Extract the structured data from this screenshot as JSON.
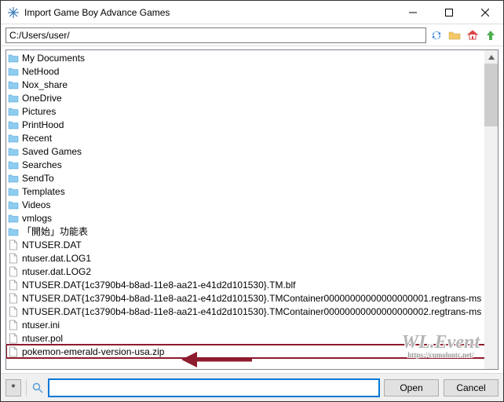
{
  "window": {
    "title": "Import Game Boy Advance Games"
  },
  "toolbar": {
    "path": "C:/Users/user/"
  },
  "files": [
    {
      "type": "folder",
      "name": "My Documents"
    },
    {
      "type": "folder",
      "name": "NetHood"
    },
    {
      "type": "folder",
      "name": "Nox_share"
    },
    {
      "type": "folder",
      "name": "OneDrive"
    },
    {
      "type": "folder",
      "name": "Pictures"
    },
    {
      "type": "folder",
      "name": "PrintHood"
    },
    {
      "type": "folder",
      "name": "Recent"
    },
    {
      "type": "folder",
      "name": "Saved Games"
    },
    {
      "type": "folder",
      "name": "Searches"
    },
    {
      "type": "folder",
      "name": "SendTo"
    },
    {
      "type": "folder",
      "name": "Templates"
    },
    {
      "type": "folder",
      "name": "Videos"
    },
    {
      "type": "folder",
      "name": "vmlogs"
    },
    {
      "type": "folder",
      "name": "「開始」功能表"
    },
    {
      "type": "file",
      "name": "NTUSER.DAT"
    },
    {
      "type": "file",
      "name": "ntuser.dat.LOG1"
    },
    {
      "type": "file",
      "name": "ntuser.dat.LOG2"
    },
    {
      "type": "file",
      "name": "NTUSER.DAT{1c3790b4-b8ad-11e8-aa21-e41d2d101530}.TM.blf"
    },
    {
      "type": "file",
      "name": "NTUSER.DAT{1c3790b4-b8ad-11e8-aa21-e41d2d101530}.TMContainer00000000000000000001.regtrans-ms"
    },
    {
      "type": "file",
      "name": "NTUSER.DAT{1c3790b4-b8ad-11e8-aa21-e41d2d101530}.TMContainer00000000000000000002.regtrans-ms"
    },
    {
      "type": "file",
      "name": "ntuser.ini"
    },
    {
      "type": "file",
      "name": "ntuser.pol"
    },
    {
      "type": "file",
      "name": "pokemon-emerald-version-usa.zip",
      "highlight": true
    }
  ],
  "bottombar": {
    "filter": "*",
    "value": "",
    "open": "Open",
    "cancel": "Cancel"
  },
  "watermark": {
    "main": "WL.Event",
    "sub": "https://cumolontc.net/"
  }
}
